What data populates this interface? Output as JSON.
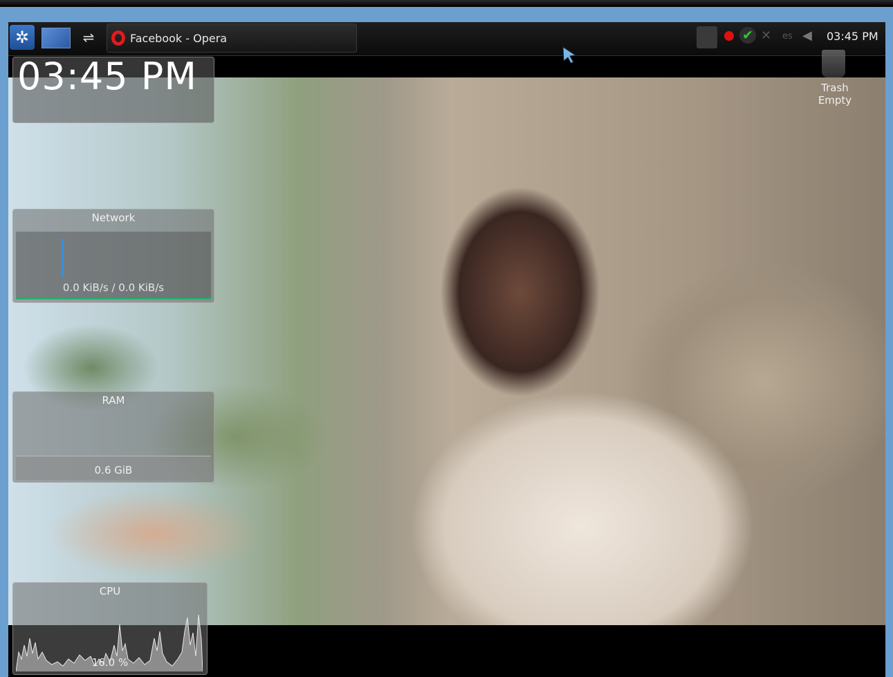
{
  "panel": {
    "task_label": "Facebook - Opera",
    "tray_language": "es",
    "clock": "03:45 PM"
  },
  "widgets": {
    "clock": "03:45 PM",
    "network": {
      "title": "Network",
      "value": "0.0 KiB/s / 0.0 KiB/s"
    },
    "ram": {
      "title": "RAM",
      "value": "0.6 GiB"
    },
    "cpu": {
      "title": "CPU",
      "value": "16.0 %"
    }
  },
  "desktop": {
    "trash_label_1": "Trash",
    "trash_label_2": "Empty"
  },
  "icons": {
    "launcher": "kde-launcher-icon",
    "desktop": "show-desktop-icon",
    "usb": "usb-icon",
    "browser": "opera-icon",
    "recording": "record-icon",
    "update": "check-icon",
    "network": "network-disconnected-icon",
    "volume": "speaker-icon",
    "trash": "trash-icon"
  },
  "colors": {
    "frame": "#6b9fcf",
    "panel": "#111111",
    "opera": "#e21b1b",
    "check": "#31c831",
    "network_graph": "#3c8fd8"
  }
}
